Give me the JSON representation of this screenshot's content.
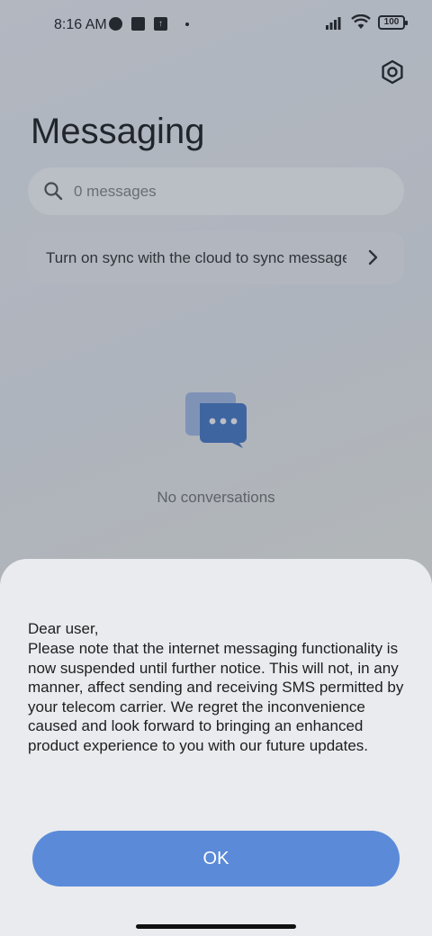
{
  "status_bar": {
    "time": "8:16 AM",
    "battery": "100"
  },
  "header": {
    "title": "Messaging",
    "settings_icon": "gear-icon"
  },
  "search": {
    "placeholder": "0 messages"
  },
  "sync_banner": {
    "text": "Turn on sync with the cloud to sync messages"
  },
  "empty_state": {
    "icon": "chat-bubbles-icon",
    "text": "No conversations"
  },
  "dialog": {
    "greeting": "Dear user,",
    "body": "Please note that the internet messaging functionality is now suspended until further notice. This will not, in any manner, affect sending and receiving SMS permitted by your telecom carrier. We regret the inconvenience caused and look forward to bringing an enhanced product experience to you with our future updates.",
    "ok_label": "OK"
  },
  "colors": {
    "accent": "#5b8ad9",
    "icon_blue": "#4a7cc9"
  }
}
